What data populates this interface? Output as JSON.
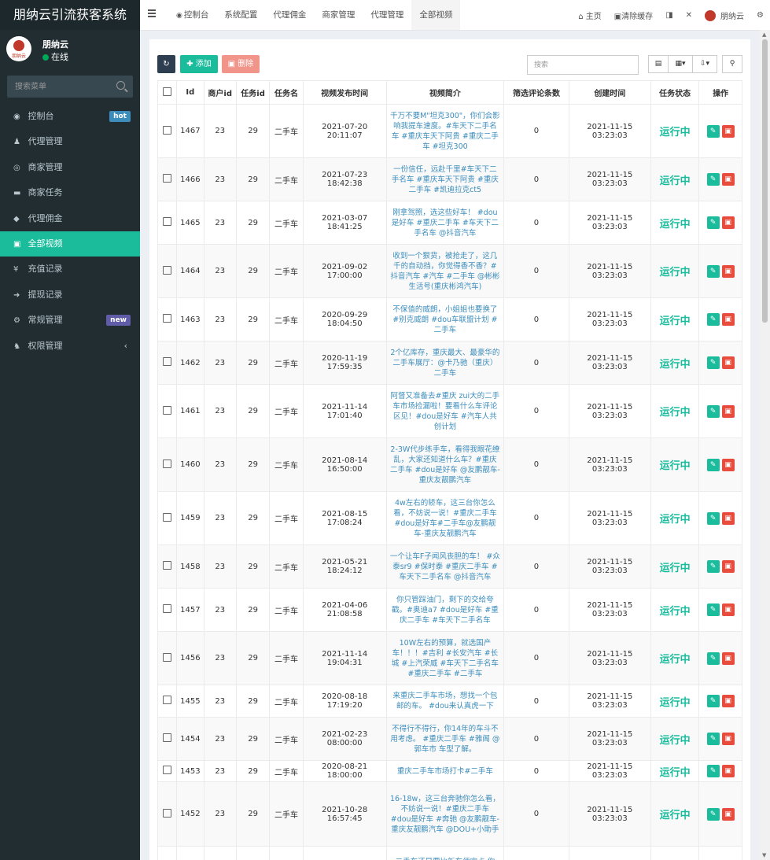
{
  "sidebar": {
    "title": "朋纳云引流获客系统",
    "user": {
      "name": "朋纳云",
      "status": "在线",
      "avatar_text": "朋纳云"
    },
    "search_placeholder": "搜索菜单",
    "menu": [
      {
        "icon": "dashboard-icon",
        "glyph": "◉",
        "label": "控制台",
        "badge": "hot"
      },
      {
        "icon": "agent-icon",
        "glyph": "♟",
        "label": "代理管理"
      },
      {
        "icon": "eye-icon",
        "glyph": "◎",
        "label": "商家管理"
      },
      {
        "icon": "card-icon",
        "glyph": "▬",
        "label": "商家任务"
      },
      {
        "icon": "diamond-icon",
        "glyph": "◆",
        "label": "代理佣金"
      },
      {
        "icon": "video-icon",
        "glyph": "▣",
        "label": "全部视频",
        "active": true
      },
      {
        "icon": "yen-icon",
        "glyph": "¥",
        "label": "充值记录"
      },
      {
        "icon": "withdraw-icon",
        "glyph": "➜",
        "label": "提现记录"
      },
      {
        "icon": "settings-icon",
        "glyph": "⚙",
        "label": "常规管理",
        "badge": "new"
      },
      {
        "icon": "users-icon",
        "glyph": "♞",
        "label": "权限管理",
        "chevron": "‹"
      }
    ]
  },
  "topbar": {
    "tabs": [
      {
        "label": "控制台",
        "icon": "dashboard-icon",
        "glyph": "◉"
      },
      {
        "label": "系统配置"
      },
      {
        "label": "代理佣金"
      },
      {
        "label": "商家管理"
      },
      {
        "label": "代理管理"
      },
      {
        "label": "全部视频",
        "active": true
      }
    ],
    "home": "主页",
    "clear_cache": "清除缓存",
    "username": "朋纳云"
  },
  "toolbar": {
    "add": "添加",
    "delete": "删除",
    "search_placeholder": "搜索"
  },
  "table": {
    "headers": [
      "Id",
      "商户id",
      "任务id",
      "任务名",
      "视频发布时间",
      "视频简介",
      "筛选评论条数",
      "创建时间",
      "任务状态",
      "操作"
    ],
    "rows": [
      {
        "id": "1467",
        "merchant_id": "23",
        "task_id": "29",
        "task_name": "二手车",
        "publish_time": "2021-07-20 20:11:07",
        "intro": "千万不要M\"坦克300\"，你们会影响我提车速度。#车天下二手名车 #重庆车天下阿贵 #重庆二手车 #坦克300",
        "comments": "0",
        "created": "2021-11-15 03:23:03",
        "status": "运行中"
      },
      {
        "id": "1466",
        "merchant_id": "23",
        "task_id": "29",
        "task_name": "二手车",
        "publish_time": "2021-07-23 18:42:38",
        "intro": "一份信任，远赴千里#车天下二手名车 #重庆车天下阿贵 #重庆二手车 #凯迪拉克ct5",
        "comments": "0",
        "created": "2021-11-15 03:23:03",
        "status": "运行中"
      },
      {
        "id": "1465",
        "merchant_id": "23",
        "task_id": "29",
        "task_name": "二手车",
        "publish_time": "2021-03-07 18:41:25",
        "intro": "刚拿驾照，选这些好车！ #dou是好车 #重庆二手车 #车天下二手名车 @抖音汽车",
        "comments": "0",
        "created": "2021-11-15 03:23:03",
        "status": "运行中"
      },
      {
        "id": "1464",
        "merchant_id": "23",
        "task_id": "29",
        "task_name": "二手车",
        "publish_time": "2021-09-02 17:00:00",
        "intro": "收到一个狠货，被抢走了，这几千的自动挡，你觉得香不香？#抖音汽车 #汽车 #二手车 @彬彬生活号(重庆彬鸿汽车)",
        "comments": "0",
        "created": "2021-11-15 03:23:03",
        "status": "运行中"
      },
      {
        "id": "1463",
        "merchant_id": "23",
        "task_id": "29",
        "task_name": "二手车",
        "publish_time": "2020-09-29 18:04:50",
        "intro": "不保值的威朗，小姐姐也要换了#别克威朗 #dou车联盟计划 #二手车",
        "comments": "0",
        "created": "2021-11-15 03:23:03",
        "status": "运行中"
      },
      {
        "id": "1462",
        "merchant_id": "23",
        "task_id": "29",
        "task_name": "二手车",
        "publish_time": "2020-11-19 17:59:35",
        "intro": "2个亿库存，重庆最大、最豪华的二手车展厅：@卡乃驰（重庆）二手车",
        "comments": "0",
        "created": "2021-11-15 03:23:03",
        "status": "运行中"
      },
      {
        "id": "1461",
        "merchant_id": "23",
        "task_id": "29",
        "task_name": "二手车",
        "publish_time": "2021-11-14 17:01:40",
        "intro": "阿督又准备去#重庆 zui大的二手车市场捡漏啦！要看什么车评论区见！#dou是好车 #汽车人共创计划",
        "comments": "0",
        "created": "2021-11-15 03:23:03",
        "status": "运行中"
      },
      {
        "id": "1460",
        "merchant_id": "23",
        "task_id": "29",
        "task_name": "二手车",
        "publish_time": "2021-08-14 16:50:00",
        "intro": "2-3W代步练手车，看得我眼花缭乱，大家还知道什么车？#重庆二手车 #dou是好车 @友鹏靓车-重庆友靓鹏汽车",
        "comments": "0",
        "created": "2021-11-15 03:23:03",
        "status": "运行中"
      },
      {
        "id": "1459",
        "merchant_id": "23",
        "task_id": "29",
        "task_name": "二手车",
        "publish_time": "2021-08-15 17:08:24",
        "intro": "4w左右的轿车，这三台你怎么看，不妨说一说！#重庆二手车 #dou是好车#二手车@友鹏靓车-重庆友靓鹏汽车",
        "comments": "0",
        "created": "2021-11-15 03:23:03",
        "status": "运行中"
      },
      {
        "id": "1458",
        "merchant_id": "23",
        "task_id": "29",
        "task_name": "二手车",
        "publish_time": "2021-05-21 18:24:12",
        "intro": "一个让车F子闻风丧胆的车！ #众泰sr9 #保时泰 #重庆二手车 #车天下二手名车 @抖音汽车",
        "comments": "0",
        "created": "2021-11-15 03:23:03",
        "status": "运行中"
      },
      {
        "id": "1457",
        "merchant_id": "23",
        "task_id": "29",
        "task_name": "二手车",
        "publish_time": "2021-04-06 21:08:58",
        "intro": "你只管踩油门，剩下的交给夸戳。#奥迪a7 #dou是好车 #重庆二手车 #车天下二手名车",
        "comments": "0",
        "created": "2021-11-15 03:23:03",
        "status": "运行中"
      },
      {
        "id": "1456",
        "merchant_id": "23",
        "task_id": "29",
        "task_name": "二手车",
        "publish_time": "2021-11-14 19:04:31",
        "intro": "10W左右的预算，就选国产车！！！#吉利 #长安汽车 #长城 #上汽荣威 #车天下二手名车 #重庆二手车 #二手车",
        "comments": "0",
        "created": "2021-11-15 03:23:03",
        "status": "运行中"
      },
      {
        "id": "1455",
        "merchant_id": "23",
        "task_id": "29",
        "task_name": "二手车",
        "publish_time": "2020-08-18 17:19:20",
        "intro": "来重庆二手车市场，想找一个包邮的车。 #dou来认真虎一下",
        "comments": "0",
        "created": "2021-11-15 03:23:03",
        "status": "运行中"
      },
      {
        "id": "1454",
        "merchant_id": "23",
        "task_id": "29",
        "task_name": "二手车",
        "publish_time": "2021-02-23 08:00:00",
        "intro": "不得行不得行，你14年的车斗不用考虑。 #重庆二手车 #雅阁 @郭车市 车型了解。",
        "comments": "0",
        "created": "2021-11-15 03:23:03",
        "status": "运行中"
      },
      {
        "id": "1453",
        "merchant_id": "23",
        "task_id": "29",
        "task_name": "二手车",
        "publish_time": "2020-08-21 18:00:00",
        "intro": "重庆二手车市场打卡#二手车",
        "comments": "0",
        "created": "2021-11-15 03:23:03",
        "status": "运行中"
      },
      {
        "id": "1452",
        "merchant_id": "23",
        "task_id": "29",
        "task_name": "二手车",
        "publish_time": "2021-10-28 16:57:45",
        "intro": "16-18w，这三台奔驰你怎么看，不妨说一说！#重庆二手车 #dou是好车 #奔驰 @友鹏靓车-重庆友靓鹏汽车 @DOU+小助手",
        "comments": "0",
        "created": "2021-11-15 03:23:03",
        "status": "运行中"
      },
      {
        "id": "",
        "merchant_id": "",
        "task_id": "",
        "task_name": "",
        "publish_time": "",
        "intro": "二手车还是要比新车便宜点 你",
        "comments": "",
        "created": "",
        "status": ""
      }
    ]
  }
}
